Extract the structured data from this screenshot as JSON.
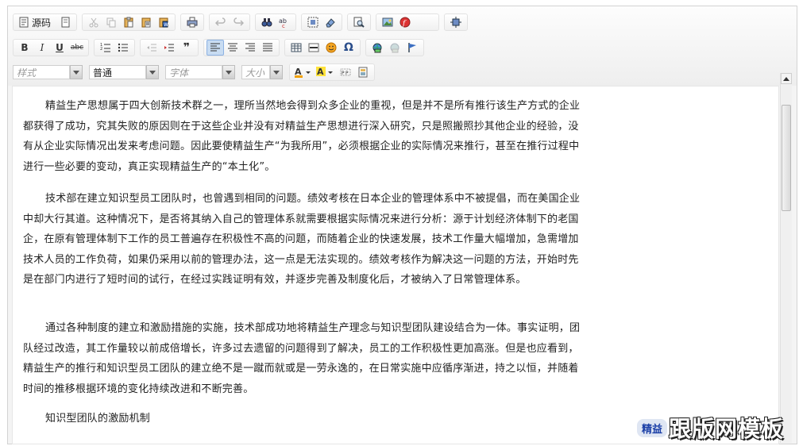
{
  "toolbar": {
    "source_label": "源码",
    "style_placeholder": "样式",
    "format_value": "普通",
    "font_placeholder": "字体",
    "size_placeholder": "大小"
  },
  "content": {
    "paragraphs": [
      "精益生产思想属于四大创新技术群之一，理所当然地会得到众多企业的重视，但是并不是所有推行该生产方式的企业都获得了成功，究其失败的原因则在于这些企业并没有对精益生产思想进行深入研究，只是照搬照抄其他企业的经验，没有从企业实际情况出发来考虑问题。因此要使精益生产“为我所用”，必须根据企业的实际情况来推行，甚至在推行过程中进行一些必要的变动，真正实现精益生产的“本土化”。",
      "技术部在建立知识型员工团队时，也曾遇到相同的问题。绩效考核在日本企业的管理体系中不被提倡，而在美国企业中却大行其道。这种情况下，是否将其纳入自己的管理体系就需要根据实际情况来进行分析：源于计划经济体制下的老国企，在原有管理体制下工作的员工普遍存在积极性不高的问题，而随着企业的快速发展，技术工作量大幅增加，急需增加技术人员的工作负荷，如果仍采用以前的管理办法，这一点是无法实现的。绩效考核作为解决这一问题的方法，开始时先是在部门内进行了短时间的试行，在经过实践证明有效，并逐步完善及制度化后，才被纳入了日常管理体系。",
      "通过各种制度的建立和激励措施的实施，技术部成功地将精益生产理念与知识型团队建设结合为一体。事实证明，团队经过改造，其工作量较以前成倍增长，许多过去遗留的问题得到了解决，员工的工作积极性更加高涨。但是也应看到，精益生产的推行和知识型员工团队的建立绝不是一蹴而就或是一劳永逸的，在日常实施中应循序渐进，持之以恒，并随着时间的推移根据环境的变化持续改进和不断完善。",
      "知识型团队的激励机制"
    ]
  },
  "watermark": {
    "chip": "精益",
    "text": "跟版网模板"
  },
  "colors": {
    "toolbar_bg": "#f4f4f4",
    "active_button": "#c8dcf2",
    "watermark_chip": "#1b3fa7"
  }
}
